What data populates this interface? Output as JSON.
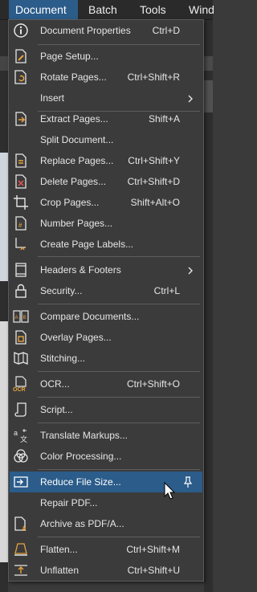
{
  "menubar": {
    "document": "Document",
    "batch": "Batch",
    "tools": "Tools",
    "window_partial": "Wind"
  },
  "menu": {
    "items": [
      {
        "label": "Document Properties",
        "shortcut": "Ctrl+D",
        "icon": "info-icon"
      },
      {
        "label": "Page Setup...",
        "shortcut": "",
        "icon": "page-setup-icon"
      },
      {
        "label": "Rotate Pages...",
        "shortcut": "Ctrl+Shift+R",
        "icon": "rotate-pages-icon"
      },
      {
        "label": "Insert",
        "shortcut": "",
        "icon": "",
        "submenu": true
      },
      {
        "label": "Extract Pages...",
        "shortcut": "Shift+A",
        "icon": "extract-pages-icon"
      },
      {
        "label": "Split Document...",
        "shortcut": "",
        "icon": ""
      },
      {
        "label": "Replace Pages...",
        "shortcut": "Ctrl+Shift+Y",
        "icon": "replace-pages-icon"
      },
      {
        "label": "Delete Pages...",
        "shortcut": "Ctrl+Shift+D",
        "icon": "delete-pages-icon"
      },
      {
        "label": "Crop Pages...",
        "shortcut": "Shift+Alt+O",
        "icon": "crop-icon"
      },
      {
        "label": "Number Pages...",
        "shortcut": "",
        "icon": "number-pages-icon"
      },
      {
        "label": "Create Page Labels...",
        "shortcut": "",
        "icon": "page-labels-icon"
      },
      {
        "label": "Headers & Footers",
        "shortcut": "",
        "icon": "headers-footers-icon",
        "submenu": true
      },
      {
        "label": "Security...",
        "shortcut": "Ctrl+L",
        "icon": "lock-icon"
      },
      {
        "label": "Compare Documents...",
        "shortcut": "",
        "icon": "compare-icon"
      },
      {
        "label": "Overlay Pages...",
        "shortcut": "",
        "icon": "overlay-icon"
      },
      {
        "label": "Stitching...",
        "shortcut": "",
        "icon": "stitching-icon"
      },
      {
        "label": "OCR...",
        "shortcut": "Ctrl+Shift+O",
        "icon": "ocr-icon"
      },
      {
        "label": "Script...",
        "shortcut": "",
        "icon": "script-icon"
      },
      {
        "label": "Translate Markups...",
        "shortcut": "",
        "icon": "translate-icon"
      },
      {
        "label": "Color Processing...",
        "shortcut": "",
        "icon": "color-processing-icon"
      },
      {
        "label": "Reduce File Size...",
        "shortcut": "",
        "icon": "reduce-file-size-icon",
        "highlighted": true,
        "pin": true
      },
      {
        "label": "Repair PDF...",
        "shortcut": "",
        "icon": ""
      },
      {
        "label": "Archive as PDF/A...",
        "shortcut": "",
        "icon": "archive-pdfa-icon"
      },
      {
        "label": "Flatten...",
        "shortcut": "Ctrl+Shift+M",
        "icon": "flatten-icon"
      },
      {
        "label": "Unflatten",
        "shortcut": "Ctrl+Shift+U",
        "icon": "unflatten-icon"
      }
    ]
  },
  "colors": {
    "menu_bg": "#3b3b3b",
    "highlight": "#2b5c8a",
    "text": "#e6e6e6",
    "separator": "#5e5e5e",
    "icon_accent": "#e8a33c"
  }
}
